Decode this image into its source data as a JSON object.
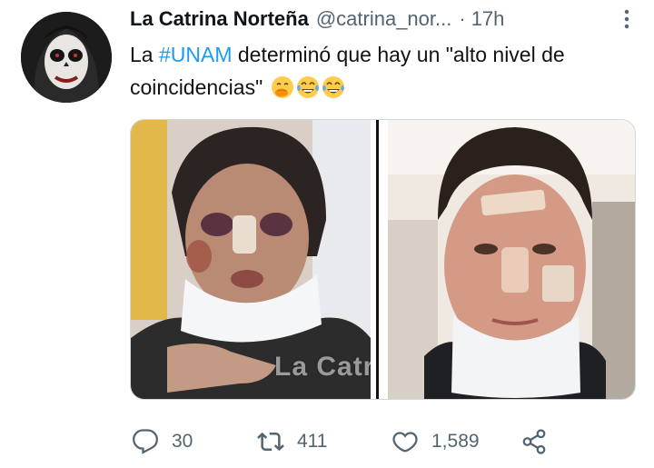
{
  "tweet": {
    "display_name": "La Catrina Norteña",
    "handle": "@catrina_nor...",
    "separator": "·",
    "time": "17h",
    "text_before": "La ",
    "hashtag": "#UNAM",
    "text_after": " determinó que hay un \"alto nivel de coincidencias\"",
    "emojis": [
      "face-with-hand-over-mouth",
      "tears-of-joy",
      "tears-of-joy"
    ],
    "media_watermark": "La Catrina"
  },
  "actions": {
    "replies": "30",
    "retweets": "411",
    "likes": "1,589"
  },
  "colors": {
    "accent": "#1d9bf0",
    "secondary_text": "#536471",
    "primary_text": "#0f1419"
  }
}
